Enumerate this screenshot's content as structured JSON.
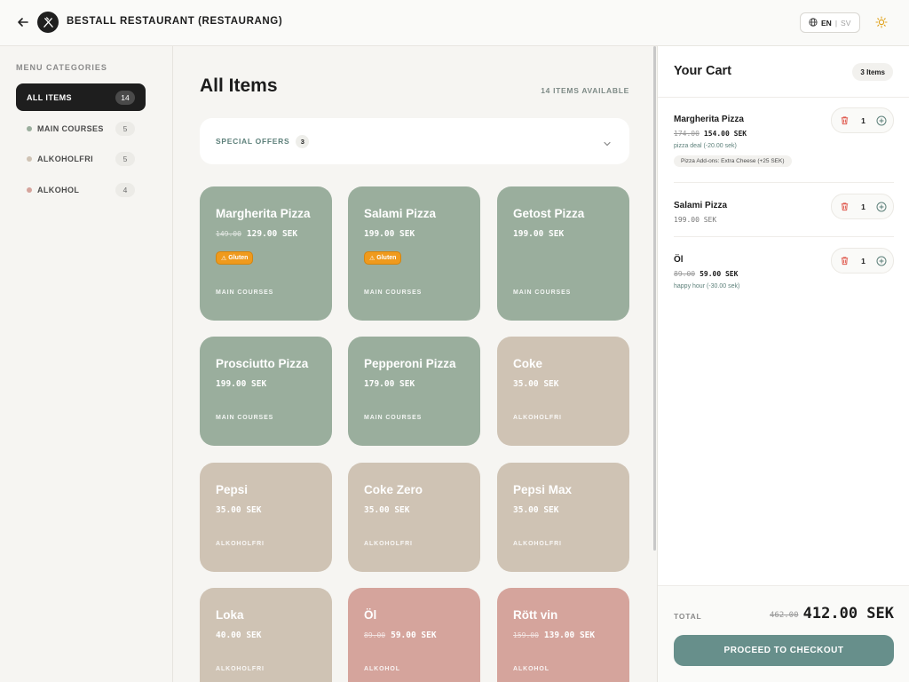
{
  "header": {
    "title": "BESTALL RESTAURANT (RESTAURANG)",
    "lang_active": "EN",
    "lang_sep": "|",
    "lang_other": "SV",
    "icons": [
      "arrow-left-icon",
      "fork-knife-logo-icon",
      "globe-icon",
      "sun-icon"
    ]
  },
  "sidebar": {
    "title": "MENU CATEGORIES",
    "items": [
      {
        "label": "ALL ITEMS",
        "count": "14",
        "color": "#1e1e1e"
      },
      {
        "label": "MAIN COURSES",
        "count": "5",
        "color": "#9aae9d"
      },
      {
        "label": "ALKOHOLFRI",
        "count": "5",
        "color": "#cfc3b4"
      },
      {
        "label": "ALKOHOL",
        "count": "4",
        "color": "#d5a49c"
      }
    ]
  },
  "main": {
    "title": "All Items",
    "available": "14 ITEMS AVAILABLE",
    "special_offers": {
      "label": "SPECIAL OFFERS",
      "count": "3"
    },
    "items": [
      {
        "name": "Margherita Pizza",
        "old_price": "149.00",
        "price": "129.00 SEK",
        "badge": "Gluten",
        "category": "MAIN COURSES",
        "color": "green"
      },
      {
        "name": "Salami Pizza",
        "old_price": "",
        "price": "199.00 SEK",
        "badge": "Gluten",
        "category": "MAIN COURSES",
        "color": "green"
      },
      {
        "name": "Getost Pizza",
        "old_price": "",
        "price": "199.00 SEK",
        "badge": "",
        "category": "MAIN COURSES",
        "color": "green"
      },
      {
        "name": "Prosciutto Pizza",
        "old_price": "",
        "price": "199.00 SEK",
        "badge": "",
        "category": "MAIN COURSES",
        "color": "green"
      },
      {
        "name": "Pepperoni Pizza",
        "old_price": "",
        "price": "179.00 SEK",
        "badge": "",
        "category": "MAIN COURSES",
        "color": "green"
      },
      {
        "name": "Coke",
        "old_price": "",
        "price": "35.00 SEK",
        "badge": "",
        "category": "ALKOHOLFRI",
        "color": "beige"
      },
      {
        "name": "Pepsi",
        "old_price": "",
        "price": "35.00 SEK",
        "badge": "",
        "category": "ALKOHOLFRI",
        "color": "beige"
      },
      {
        "name": "Coke Zero",
        "old_price": "",
        "price": "35.00 SEK",
        "badge": "",
        "category": "ALKOHOLFRI",
        "color": "beige"
      },
      {
        "name": "Pepsi Max",
        "old_price": "",
        "price": "35.00 SEK",
        "badge": "",
        "category": "ALKOHOLFRI",
        "color": "beige"
      },
      {
        "name": "Loka",
        "old_price": "",
        "price": "40.00 SEK",
        "badge": "",
        "category": "ALKOHOLFRI",
        "color": "beige"
      },
      {
        "name": "Öl",
        "old_price": "89.00",
        "price": "59.00 SEK",
        "badge": "",
        "category": "ALKOHOL",
        "color": "pink"
      },
      {
        "name": "Rött vin",
        "old_price": "159.00",
        "price": "139.00 SEK",
        "badge": "",
        "category": "ALKOHOL",
        "color": "pink"
      }
    ]
  },
  "cart": {
    "title": "Your Cart",
    "count": "3 Items",
    "items": [
      {
        "name": "Margherita Pizza",
        "old_price": "174.00",
        "price": "154.00 SEK",
        "deal": "pizza deal (-20.00 sek)",
        "addon": "Pizza Add-ons: Extra Cheese (+25 SEK)",
        "qty": "1"
      },
      {
        "name": "Salami Pizza",
        "old_price": "",
        "price": "199.00 SEK",
        "deal": "",
        "addon": "",
        "qty": "1"
      },
      {
        "name": "Öl",
        "old_price": "89.00",
        "price": "59.00 SEK",
        "deal": "happy hour (-30.00 sek)",
        "addon": "",
        "qty": "1"
      }
    ],
    "total_label": "TOTAL",
    "total_old": "462.00",
    "total": "412.00 SEK",
    "checkout_label": "PROCEED TO CHECKOUT"
  },
  "colors": {
    "accent": "#678f8b",
    "main_course_card": "#9aae9d",
    "alkoholfri_card": "#cfc3b4",
    "alkohol_card": "#d5a49c",
    "gluten_badge": "#ef9a1d",
    "delete_red": "#e05a4f"
  }
}
